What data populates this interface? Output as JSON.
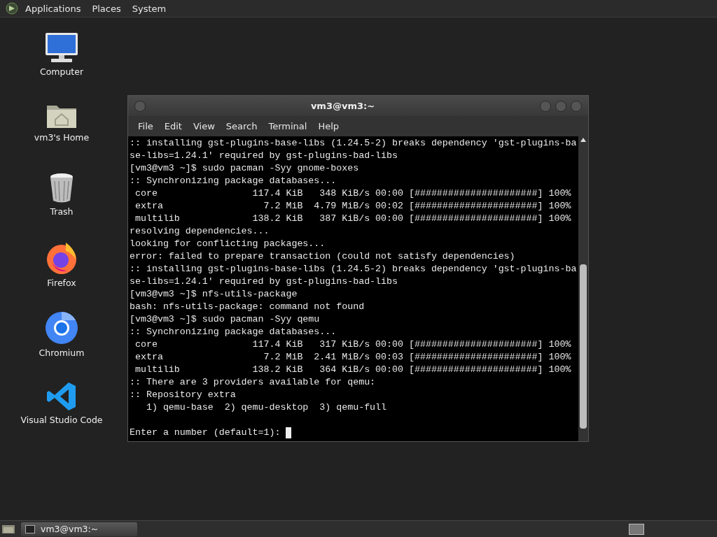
{
  "top_panel": {
    "menus": [
      "Applications",
      "Places",
      "System"
    ]
  },
  "desktop_icons": [
    {
      "kind": "computer",
      "label": "Computer"
    },
    {
      "kind": "home",
      "label": "vm3's Home"
    },
    {
      "kind": "trash",
      "label": "Trash"
    },
    {
      "kind": "firefox",
      "label": "Firefox"
    },
    {
      "kind": "chromium",
      "label": "Chromium"
    },
    {
      "kind": "vscode",
      "label": "Visual Studio Code"
    }
  ],
  "terminal": {
    "title": "vm3@vm3:~",
    "menu": [
      "File",
      "Edit",
      "View",
      "Search",
      "Terminal",
      "Help"
    ],
    "lines": [
      ":: installing gst-plugins-base-libs (1.24.5-2) breaks dependency 'gst-plugins-ba",
      "se-libs=1.24.1' required by gst-plugins-bad-libs",
      "[vm3@vm3 ~]$ sudo pacman -Syy gnome-boxes",
      ":: Synchronizing package databases...",
      " core                 117.4 KiB   348 KiB/s 00:00 [######################] 100%",
      " extra                  7.2 MiB  4.79 MiB/s 00:02 [######################] 100%",
      " multilib             138.2 KiB   387 KiB/s 00:00 [######################] 100%",
      "resolving dependencies...",
      "looking for conflicting packages...",
      "error: failed to prepare transaction (could not satisfy dependencies)",
      ":: installing gst-plugins-base-libs (1.24.5-2) breaks dependency 'gst-plugins-ba",
      "se-libs=1.24.1' required by gst-plugins-bad-libs",
      "[vm3@vm3 ~]$ nfs-utils-package",
      "bash: nfs-utils-package: command not found",
      "[vm3@vm3 ~]$ sudo pacman -Syy qemu",
      ":: Synchronizing package databases...",
      " core                 117.4 KiB   317 KiB/s 00:00 [######################] 100%",
      " extra                  7.2 MiB  2.41 MiB/s 00:03 [######################] 100%",
      " multilib             138.2 KiB   364 KiB/s 00:00 [######################] 100%",
      ":: There are 3 providers available for qemu:",
      ":: Repository extra",
      "   1) qemu-base  2) qemu-desktop  3) qemu-full"
    ],
    "prompt": "Enter a number (default=1): "
  },
  "taskbar": {
    "tasks": [
      {
        "label": "vm3@vm3:~",
        "selected": true
      }
    ]
  }
}
